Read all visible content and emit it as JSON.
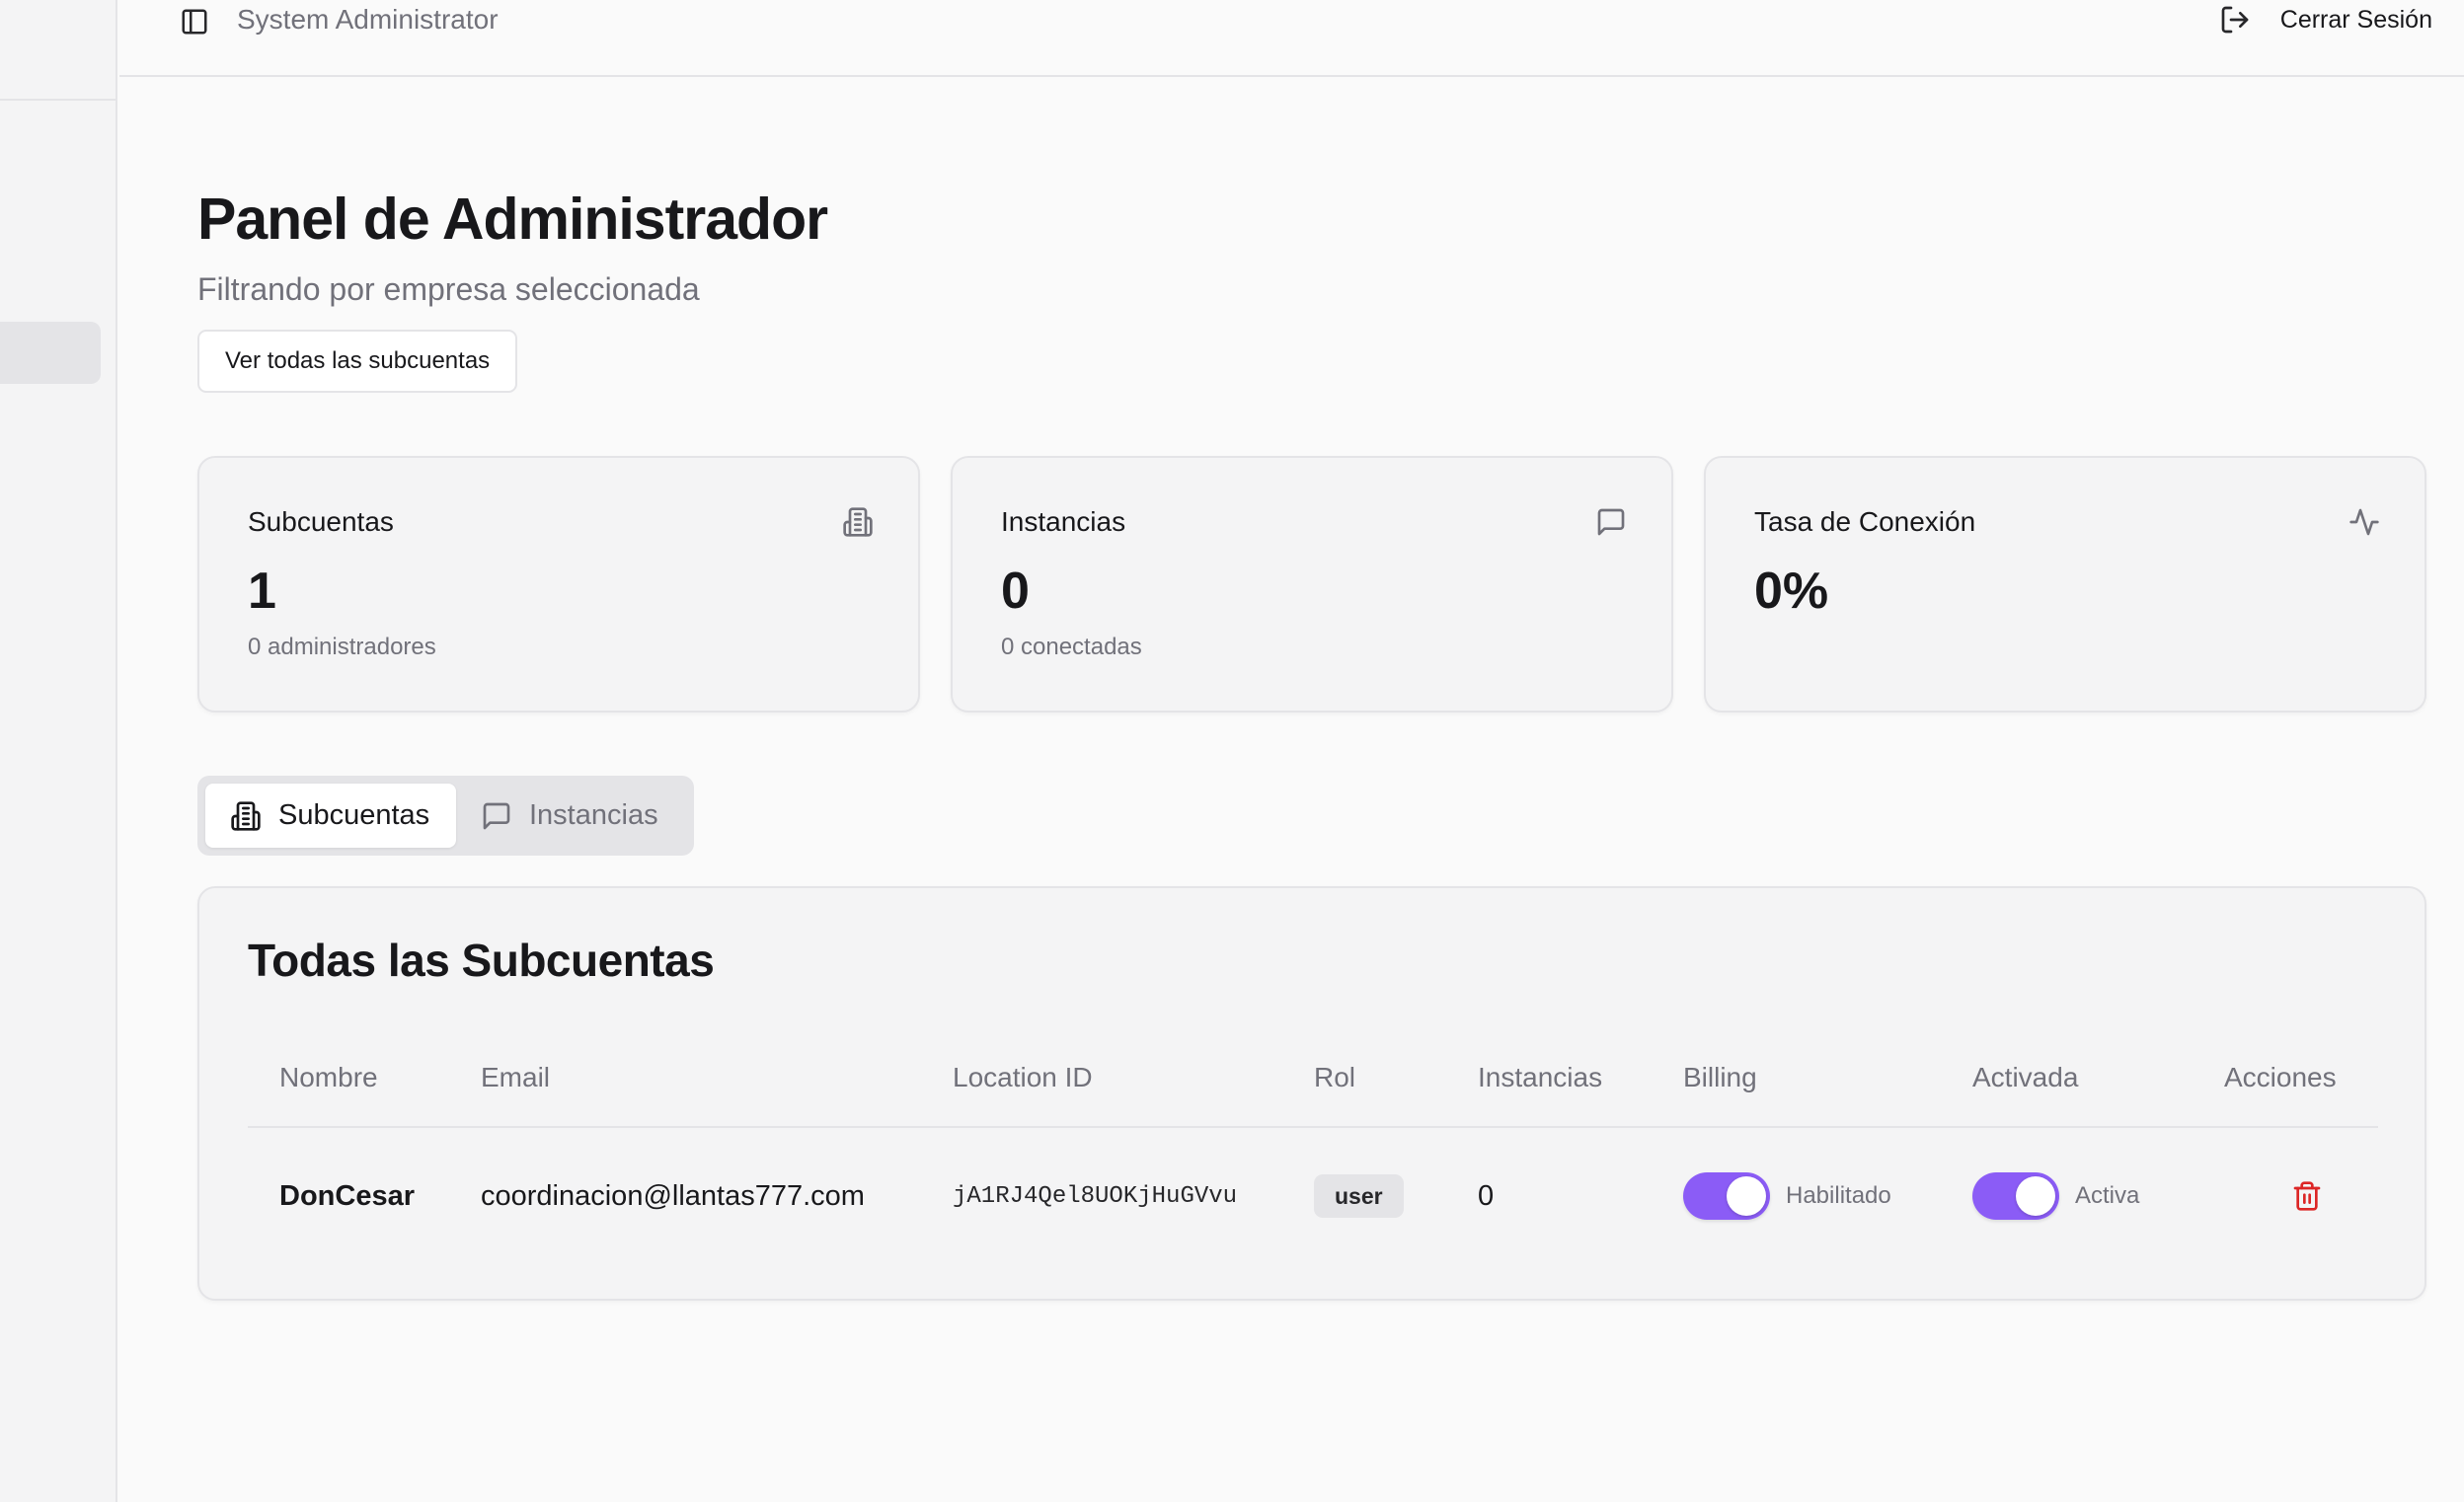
{
  "header": {
    "user_name": "System Administrator",
    "logout_label": "Cerrar Sesión"
  },
  "page": {
    "title": "Panel de Administrador",
    "subtitle": "Filtrando por empresa seleccionada",
    "view_all_label": "Ver todas las subcuentas"
  },
  "stats": [
    {
      "title": "Subcuentas",
      "value": "1",
      "sub": "0 administradores",
      "icon": "building-icon"
    },
    {
      "title": "Instancias",
      "value": "0",
      "sub": "0 conectadas",
      "icon": "message-square-icon"
    },
    {
      "title": "Tasa de Conexión",
      "value": "0%",
      "sub": "",
      "icon": "activity-icon"
    }
  ],
  "tabs": [
    {
      "label": "Subcuentas",
      "active": true,
      "icon": "building-icon"
    },
    {
      "label": "Instancias",
      "active": false,
      "icon": "message-square-icon"
    }
  ],
  "table": {
    "title": "Todas las Subcuentas",
    "columns": [
      "Nombre",
      "Email",
      "Location ID",
      "Rol",
      "Instancias",
      "Billing",
      "Activada",
      "Acciones"
    ],
    "rows": [
      {
        "name": "DonCesar",
        "email": "coordinacion@llantas777.com",
        "location_id": "jA1RJ4Qel8UOKjHuGVvu",
        "role": "user",
        "instances": "0",
        "billing_enabled": true,
        "billing_label": "Habilitado",
        "activated": true,
        "activated_label": "Activa"
      }
    ]
  },
  "colors": {
    "accent": "#8b5cf6",
    "danger": "#dc2626",
    "muted_text": "#71717a",
    "card_bg": "#f4f4f5",
    "border": "#e4e4e7"
  }
}
